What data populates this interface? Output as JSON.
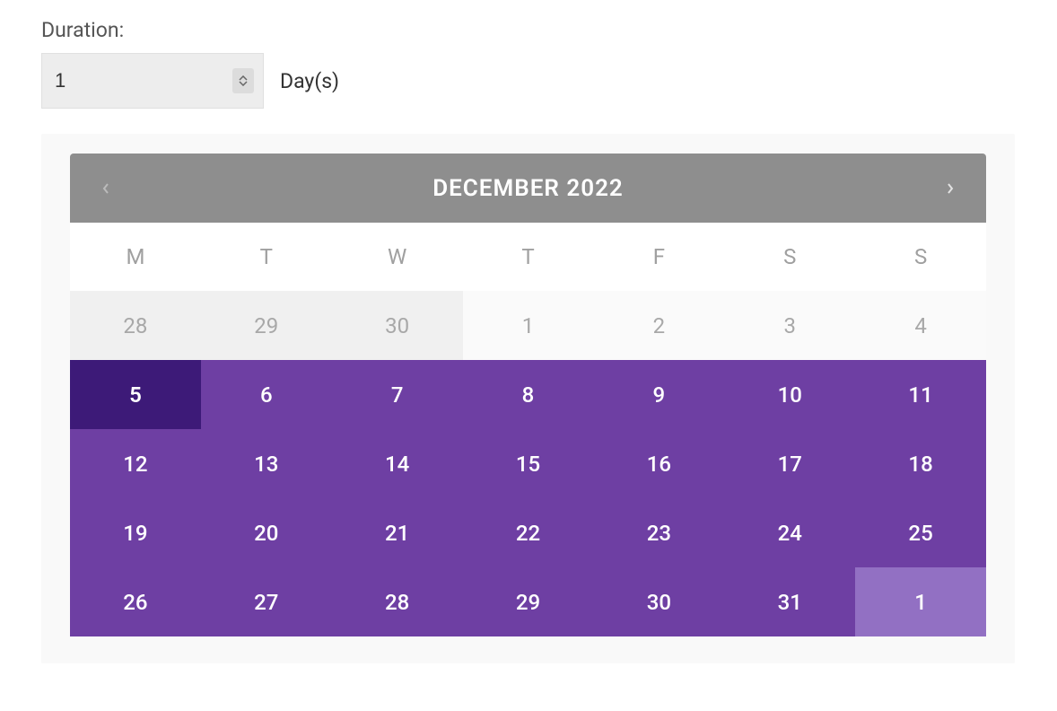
{
  "duration": {
    "label": "Duration:",
    "value": "1",
    "unit": "Day(s)"
  },
  "calendar": {
    "title": "DECEMBER 2022",
    "weekdays": [
      "M",
      "T",
      "W",
      "T",
      "F",
      "S",
      "S"
    ],
    "weeks": [
      [
        {
          "n": "28",
          "state": "other-month"
        },
        {
          "n": "29",
          "state": "other-month"
        },
        {
          "n": "30",
          "state": "other-month"
        },
        {
          "n": "1",
          "state": "current-month-out"
        },
        {
          "n": "2",
          "state": "current-month-out"
        },
        {
          "n": "3",
          "state": "current-month-out"
        },
        {
          "n": "4",
          "state": "current-month-out"
        }
      ],
      [
        {
          "n": "5",
          "state": "range-start"
        },
        {
          "n": "6",
          "state": "in-range"
        },
        {
          "n": "7",
          "state": "in-range"
        },
        {
          "n": "8",
          "state": "in-range"
        },
        {
          "n": "9",
          "state": "in-range"
        },
        {
          "n": "10",
          "state": "in-range"
        },
        {
          "n": "11",
          "state": "in-range"
        }
      ],
      [
        {
          "n": "12",
          "state": "in-range"
        },
        {
          "n": "13",
          "state": "in-range"
        },
        {
          "n": "14",
          "state": "in-range"
        },
        {
          "n": "15",
          "state": "in-range"
        },
        {
          "n": "16",
          "state": "in-range"
        },
        {
          "n": "17",
          "state": "in-range"
        },
        {
          "n": "18",
          "state": "in-range"
        }
      ],
      [
        {
          "n": "19",
          "state": "in-range"
        },
        {
          "n": "20",
          "state": "in-range"
        },
        {
          "n": "21",
          "state": "in-range"
        },
        {
          "n": "22",
          "state": "in-range"
        },
        {
          "n": "23",
          "state": "in-range"
        },
        {
          "n": "24",
          "state": "in-range"
        },
        {
          "n": "25",
          "state": "in-range"
        }
      ],
      [
        {
          "n": "26",
          "state": "in-range"
        },
        {
          "n": "27",
          "state": "in-range"
        },
        {
          "n": "28",
          "state": "in-range"
        },
        {
          "n": "29",
          "state": "in-range"
        },
        {
          "n": "30",
          "state": "in-range"
        },
        {
          "n": "31",
          "state": "in-range"
        },
        {
          "n": "1",
          "state": "range-end-next"
        }
      ]
    ]
  }
}
